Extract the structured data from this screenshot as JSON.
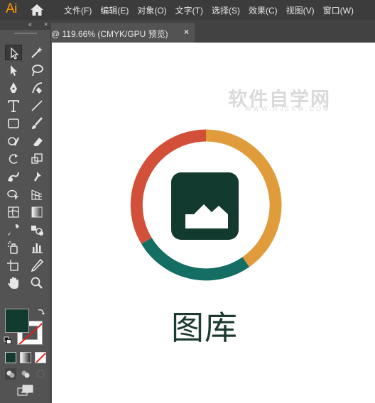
{
  "app": {
    "logo_text": "Ai"
  },
  "menu": {
    "items": [
      "文件(F)",
      "编辑(E)",
      "对象(O)",
      "文字(T)",
      "选择(S)",
      "效果(C)",
      "视图(V)",
      "窗口(W)"
    ]
  },
  "tabs": [
    {
      "label": "@ 119.66% (CMYK/GPU 预览)",
      "close": "×"
    }
  ],
  "toolpanel": {
    "collapse_glyph": "«",
    "close_glyph": "×",
    "more_glyph": "•••"
  },
  "artboard": {
    "watermark": "软件自学网",
    "watermark_sub": "WWW.RJZXW.COM",
    "caption": "图库"
  },
  "colors": {
    "ring_orange": "#e09b3a",
    "ring_red": "#d2503a",
    "ring_teal": "#146e63",
    "icon_dark": "#133a2f",
    "fill_swatch": "#133a2f",
    "accent_logo": "#ff9a00"
  }
}
